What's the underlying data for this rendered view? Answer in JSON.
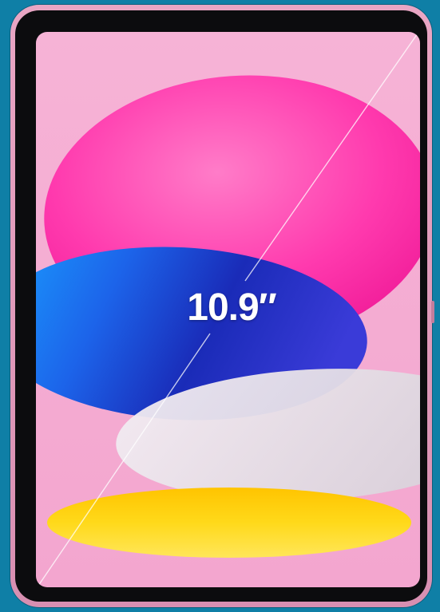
{
  "screen": {
    "size_label": "10.9″"
  },
  "colors": {
    "background": "#0f7fa6",
    "body": "#e9a6c4",
    "bezel": "#0c0c0e",
    "wallpaper_pink": "#f6b3d6",
    "magenta_shape": "#ff3fb0",
    "blue_shape": "#1f7cf0",
    "silver_shape": "#e8e4ea",
    "yellow_shape": "#ffd400"
  }
}
